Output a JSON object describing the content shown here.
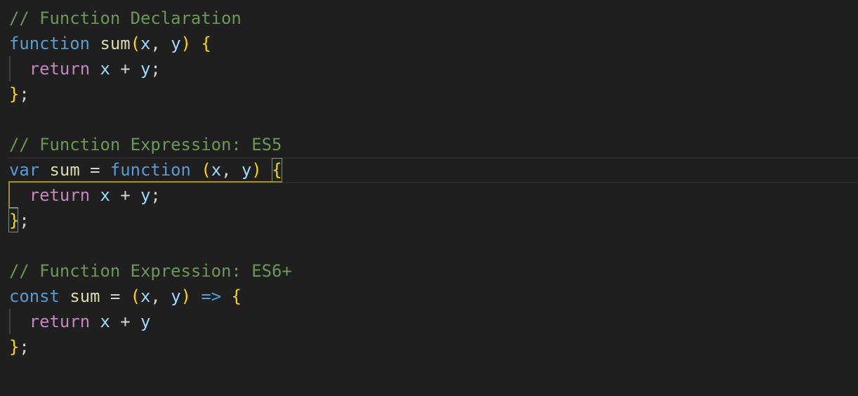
{
  "editor": {
    "theme_colors": {
      "background": "#1f1f1f",
      "comment": "#6a9955",
      "keyword": "#569cd6",
      "control": "#c586c0",
      "function": "#dcdcaa",
      "parameter": "#9cdcfe",
      "brace": "#ffd700",
      "bracket_guide": "#a88b2c"
    },
    "lines": [
      {
        "comment": "// Function Declaration"
      },
      {
        "kw": "function",
        "sp1": " ",
        "fn": "sum",
        "open_paren": "(",
        "p1": "x",
        "comma": ", ",
        "p2": "y",
        "close_paren": ")",
        "sp2": " ",
        "brace": "{"
      },
      {
        "indent": "  ",
        "ctrl": "return",
        "sp1": " ",
        "a": "x",
        "op": " + ",
        "b": "y",
        "semi": ";"
      },
      {
        "brace": "}",
        "semi": ";"
      },
      {},
      {
        "comment": "// Function Expression: ES5"
      },
      {
        "kw": "var",
        "sp1": " ",
        "fn": "sum",
        "eq": " = ",
        "kw2": "function",
        "sp2": " ",
        "open_paren": "(",
        "p1": "x",
        "comma": ", ",
        "p2": "y",
        "close_paren": ")",
        "sp3": " ",
        "brace": "{"
      },
      {
        "indent": "  ",
        "ctrl": "return",
        "sp1": " ",
        "a": "x",
        "op": " + ",
        "b": "y",
        "semi": ";"
      },
      {
        "brace": "}",
        "semi": ";"
      },
      {},
      {
        "comment": "// Function Expression: ES6+"
      },
      {
        "kw": "const",
        "sp1": " ",
        "fn": "sum",
        "eq": " = ",
        "open_paren": "(",
        "p1": "x",
        "comma": ", ",
        "p2": "y",
        "close_paren": ")",
        "sp2": " ",
        "arrow": "=>",
        "sp3": " ",
        "brace": "{"
      },
      {
        "indent": "  ",
        "ctrl": "return",
        "sp1": " ",
        "a": "x",
        "op": " + ",
        "b": "y"
      },
      {
        "brace": "}",
        "semi": ";"
      }
    ]
  }
}
